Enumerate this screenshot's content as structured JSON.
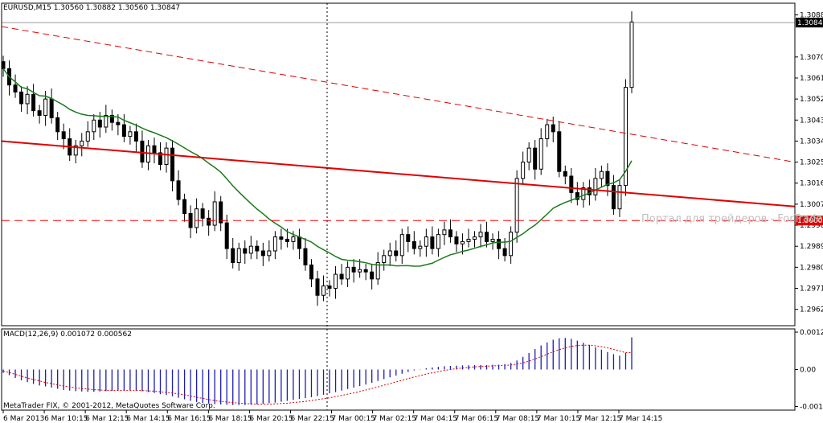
{
  "window": {
    "symbol_header": "EURUSD,M15  1.30560 1.30882 1.30560 1.30847",
    "macd_header": "MACD(12,26,9) 0.001072 0.000562",
    "copyright": "MetaTrader FIX, © 2001-2012, MetaQuotes Software Corp.",
    "watermark": "Портал для трейдеров - ForTrader.ru"
  },
  "colors": {
    "background": "#ffffff",
    "candle": "#000000",
    "moving_average": "#1a7a1a",
    "trendline": "#e00000",
    "level_line": "#ff0000",
    "macd_hist": "#1c1cb4",
    "macd_signal": "#e00000",
    "price_tag_bg": "#000000",
    "level_tag_bg": "#e00000"
  },
  "chart_data": [
    {
      "type": "candlestick",
      "symbol": "EURUSD",
      "timeframe": "M15",
      "ohlc_last": {
        "open": 1.3056,
        "high": 1.30882,
        "low": 1.3056,
        "close": 1.30847
      },
      "ylim": [
        1.2955,
        1.3093
      ],
      "y_ticks": [
        "1.30880",
        "1.30700",
        "1.30610",
        "1.30520",
        "1.30430",
        "1.30340",
        "1.30250",
        "1.30160",
        "1.30070",
        "1.29980",
        "1.29890",
        "1.29800",
        "1.29710",
        "1.29620"
      ],
      "x_ticks": [
        "6 Mar 2013",
        "6 Mar 10:15",
        "6 Mar 12:15",
        "6 Mar 14:15",
        "6 Mar 16:15",
        "6 Mar 18:15",
        "6 Mar 20:15",
        "6 Mar 22:15",
        "7 Mar 00:15",
        "7 Mar 02:15",
        "7 Mar 04:15",
        "7 Mar 06:15",
        "7 Mar 08:15",
        "7 Mar 10:15",
        "7 Mar 12:15",
        "7 Mar 14:15"
      ],
      "current_price_label": "1.30847",
      "level_label": "1.30000",
      "level": 1.3,
      "closes": [
        1.3065,
        1.3058,
        1.3055,
        1.305,
        1.3054,
        1.3047,
        1.3045,
        1.3052,
        1.3044,
        1.3038,
        1.3035,
        1.3028,
        1.3032,
        1.3034,
        1.3038,
        1.3043,
        1.304,
        1.3045,
        1.3042,
        1.3041,
        1.3036,
        1.3038,
        1.3034,
        1.3025,
        1.3032,
        1.3029,
        1.3024,
        1.3031,
        1.3017,
        1.3009,
        1.3003,
        1.2997,
        1.3005,
        1.3001,
        1.2998,
        1.3008,
        1.2999,
        1.2988,
        1.2982,
        1.2988,
        1.2986,
        1.2989,
        1.2987,
        1.2985,
        1.2987,
        1.2993,
        1.2992,
        1.2991,
        1.2993,
        1.2988,
        1.2981,
        1.2975,
        1.2968,
        1.2972,
        1.2971,
        1.2977,
        1.2975,
        1.298,
        1.2978,
        1.2979,
        1.2978,
        1.2975,
        1.2982,
        1.2985,
        1.2987,
        1.2985,
        1.2994,
        1.2991,
        1.2988,
        1.2989,
        1.2993,
        1.2988,
        1.2994,
        1.2996,
        1.2993,
        1.299,
        1.2991,
        1.2992,
        1.2993,
        1.2995,
        1.2991,
        1.2992,
        1.2988,
        1.2985,
        1.2995,
        1.3018,
        1.3025,
        1.3031,
        1.3022,
        1.3035,
        1.3041,
        1.3038,
        1.3021,
        1.3019,
        1.3012,
        1.3009,
        1.3014,
        1.3011,
        1.3018,
        1.3021,
        1.3015,
        1.3005,
        1.3015,
        1.3057,
        1.3085
      ],
      "moving_average_type": "line (green)",
      "indicator": {
        "name": "MACD(12,26,9)",
        "main": 0.001072,
        "signal": 0.000562,
        "y_ticks": [
          "0.001276",
          "0.00",
          "-0.001228"
        ],
        "histogram": [
          -0.00011,
          -0.00019,
          -0.00028,
          -0.00036,
          -0.00042,
          -0.00048,
          -0.00053,
          -0.00056,
          -0.0006,
          -0.00064,
          -0.00068,
          -0.0007,
          -0.00072,
          -0.00073,
          -0.00074,
          -0.00074,
          -0.00073,
          -0.00072,
          -0.00071,
          -0.0007,
          -0.0007,
          -0.00069,
          -0.0007,
          -0.00072,
          -0.00075,
          -0.00078,
          -0.00082,
          -0.00085,
          -0.00089,
          -0.00094,
          -0.00099,
          -0.00104,
          -0.00108,
          -0.00111,
          -0.00113,
          -0.00115,
          -0.00116,
          -0.00117,
          -0.00118,
          -0.00118,
          -0.00118,
          -0.00117,
          -0.00116,
          -0.00114,
          -0.00112,
          -0.0011,
          -0.00107,
          -0.00104,
          -0.00101,
          -0.00098,
          -0.00095,
          -0.00092,
          -0.00088,
          -0.00084,
          -0.00079,
          -0.00075,
          -0.0007,
          -0.00065,
          -0.0006,
          -0.00055,
          -0.0005,
          -0.00044,
          -0.00038,
          -0.00032,
          -0.00026,
          -0.0002,
          -0.00014,
          -8e-05,
          -3e-05,
          1e-05,
          4e-05,
          7e-05,
          9e-05,
          0.00011,
          0.00012,
          0.00013,
          0.00014,
          0.00014,
          0.00015,
          0.00015,
          0.00015,
          0.00016,
          0.00016,
          0.00018,
          0.00022,
          0.0003,
          0.00042,
          0.00055,
          0.00068,
          0.0008,
          0.0009,
          0.00099,
          0.00104,
          0.00105,
          0.00102,
          0.00096,
          0.00089,
          0.00082,
          0.00074,
          0.00066,
          0.00058,
          0.00051,
          0.00046,
          0.00055,
          0.00107
        ],
        "signal_series": [
          -5e-05,
          -0.0001,
          -0.00016,
          -0.00022,
          -0.00028,
          -0.00033,
          -0.00038,
          -0.00043,
          -0.00047,
          -0.00051,
          -0.00055,
          -0.00058,
          -0.00061,
          -0.00063,
          -0.00065,
          -0.00067,
          -0.00068,
          -0.00069,
          -0.0007,
          -0.0007,
          -0.0007,
          -0.0007,
          -0.0007,
          -0.0007,
          -0.00071,
          -0.00072,
          -0.00074,
          -0.00076,
          -0.00078,
          -0.00081,
          -0.00084,
          -0.00088,
          -0.00092,
          -0.00096,
          -0.001,
          -0.00103,
          -0.00106,
          -0.00108,
          -0.0011,
          -0.00112,
          -0.00113,
          -0.00114,
          -0.00115,
          -0.00115,
          -0.00115,
          -0.00114,
          -0.00113,
          -0.00112,
          -0.0011,
          -0.00108,
          -0.00106,
          -0.00103,
          -0.001,
          -0.00097,
          -0.00094,
          -0.0009,
          -0.00086,
          -0.00082,
          -0.00078,
          -0.00073,
          -0.00068,
          -0.00063,
          -0.00058,
          -0.00052,
          -0.00047,
          -0.00041,
          -0.00036,
          -0.0003,
          -0.00025,
          -0.0002,
          -0.00015,
          -0.00011,
          -7e-05,
          -3e-05,
          0.0,
          3e-05,
          5e-05,
          7e-05,
          9e-05,
          0.0001,
          0.00011,
          0.00012,
          0.00013,
          0.00014,
          0.00015,
          0.00018,
          0.00022,
          0.00028,
          0.00035,
          0.00043,
          0.00051,
          0.00059,
          0.00066,
          0.00072,
          0.00077,
          0.0008,
          0.00081,
          0.00081,
          0.00079,
          0.00076,
          0.00072,
          0.00067,
          0.00062,
          0.00056,
          0.00056
        ]
      }
    }
  ]
}
